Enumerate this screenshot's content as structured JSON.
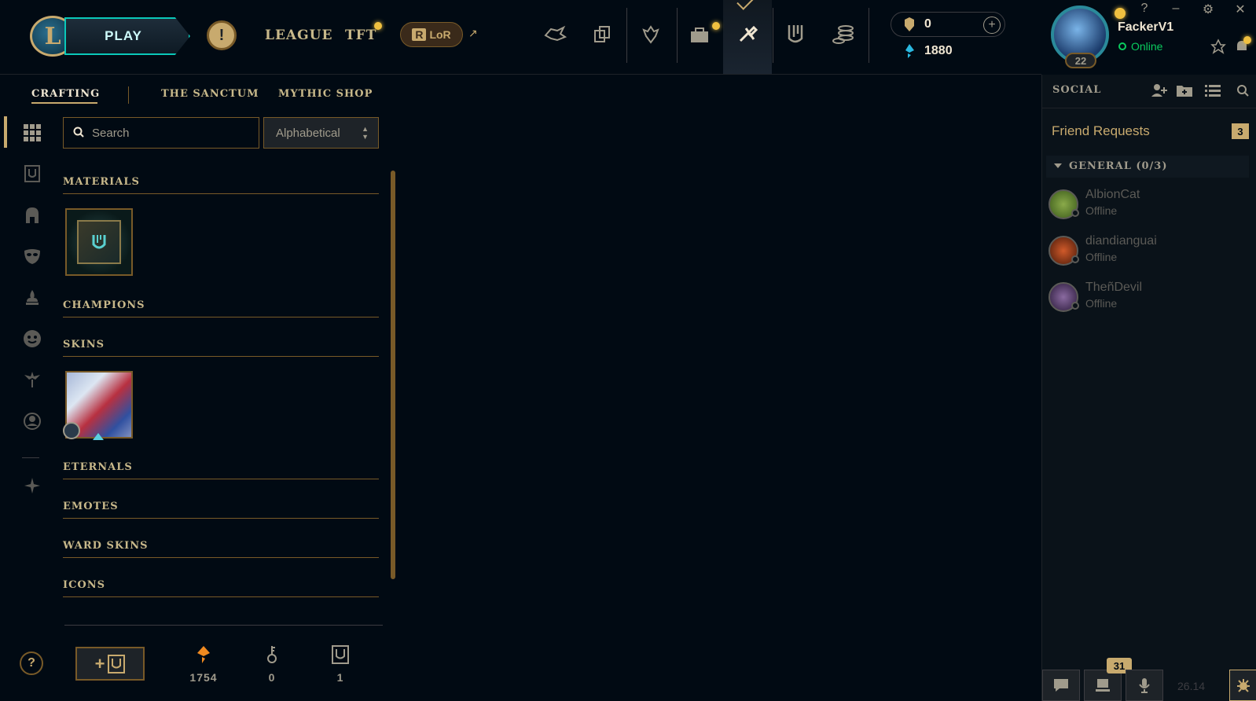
{
  "top": {
    "logo_letter": "L",
    "play_label": "PLAY",
    "alert_glyph": "!",
    "nav": [
      "LEAGUE",
      "TFT"
    ],
    "lor_label": "LoR",
    "lor_icon": "R",
    "ext_arrow": "↗",
    "nav_icons": [
      "riot-hand-icon",
      "collection-cards-icon",
      "tft-little-legend-icon",
      "store-bag-icon",
      "loot-crafting-icon",
      "clash-icon",
      "rp-coins-icon"
    ],
    "currency": {
      "rp": "0",
      "be": "1880",
      "plus": "+"
    },
    "profile": {
      "level": "22",
      "name": "FackerV1",
      "status": "Online"
    },
    "window_controls": {
      "help": "?",
      "minimize": "–",
      "settings": "⚙",
      "close": "✕"
    }
  },
  "subnav": {
    "items": [
      "CRAFTING",
      "THE SANCTUM",
      "MYTHIC SHOP"
    ],
    "active": "CRAFTING"
  },
  "search": {
    "placeholder": "Search",
    "value": ""
  },
  "sort": {
    "selected": "Alphabetical"
  },
  "sections": [
    "MATERIALS",
    "CHAMPIONS",
    "SKINS",
    "ETERNALS",
    "EMOTES",
    "WARD SKINS",
    "ICONS"
  ],
  "left_rail": {
    "icons": [
      "all-items-grid-icon",
      "chest-icon",
      "champion-helmet-icon",
      "skin-mask-icon",
      "little-legend-icon",
      "emote-face-icon",
      "ward-icon",
      "profile-icon-icon",
      "eternals-icon"
    ],
    "help": "?"
  },
  "bottom": {
    "add_btn_plus": "+",
    "add_btn_icon": "U",
    "essence": {
      "icon": "◈",
      "value": "1754"
    },
    "keys": {
      "icon": "⚷",
      "value": "0"
    },
    "chests": {
      "icon": "U",
      "value": "1"
    }
  },
  "social": {
    "title": "SOCIAL",
    "friend_requests_label": "Friend Requests",
    "friend_requests_count": "3",
    "group_label": "GENERAL (0/3)",
    "friends": [
      {
        "name": "AlbionCat",
        "status": "Offline",
        "avatar_color": "#6a8a3a"
      },
      {
        "name": "diandianguai",
        "status": "Offline",
        "avatar_color": "#8a4a2a"
      },
      {
        "name": "TheñDevil",
        "status": "Offline",
        "avatar_color": "#5a3a6a"
      }
    ],
    "bottom": {
      "notifications": "31",
      "version": "26.14"
    }
  },
  "colors": {
    "gold": "#c8aa6e",
    "teal": "#0ac8b9",
    "online": "#0acb5e",
    "background": "#010a13"
  }
}
